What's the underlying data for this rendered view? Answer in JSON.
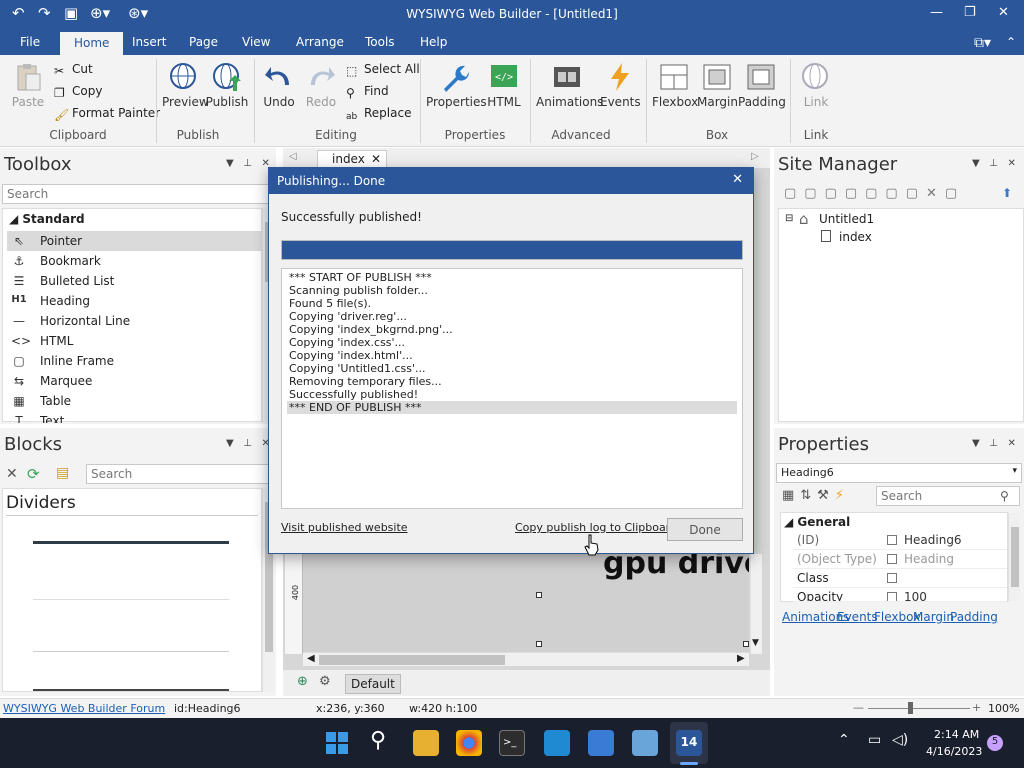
{
  "window": {
    "title": "WYSIWYG Web Builder - [Untitled1]"
  },
  "menu": [
    "File",
    "Home",
    "Insert",
    "Page",
    "View",
    "Arrange",
    "Tools",
    "Help"
  ],
  "menu_active": "Home",
  "ribbon": {
    "clipboard": {
      "paste": "Paste",
      "cut": "Cut",
      "copy": "Copy",
      "format_painter": "Format Painter",
      "label": "Clipboard"
    },
    "publish": {
      "preview": "Preview",
      "publish": "Publish",
      "label": "Publish"
    },
    "editing": {
      "undo": "Undo",
      "redo": "Redo",
      "select_all": "Select All",
      "find": "Find",
      "replace": "Replace",
      "label": "Editing"
    },
    "properties": {
      "properties": "Properties",
      "html": "HTML",
      "label": "Properties"
    },
    "advanced": {
      "animations": "Animations",
      "events": "Events",
      "label": "Advanced"
    },
    "box": {
      "flexbox": "Flexbox",
      "margin": "Margin",
      "padding": "Padding",
      "label": "Box"
    },
    "link": {
      "link": "Link",
      "label": "Link"
    }
  },
  "toolbox": {
    "title": "Toolbox",
    "search_placeholder": "Search",
    "category": "Standard",
    "items": [
      {
        "label": "Pointer",
        "icon": "pointer-icon"
      },
      {
        "label": "Bookmark",
        "icon": "anchor-icon"
      },
      {
        "label": "Bulleted List",
        "icon": "list-icon"
      },
      {
        "label": "Heading",
        "icon": "heading-icon"
      },
      {
        "label": "Horizontal Line",
        "icon": "line-icon"
      },
      {
        "label": "HTML",
        "icon": "code-icon"
      },
      {
        "label": "Inline Frame",
        "icon": "frame-icon"
      },
      {
        "label": "Marquee",
        "icon": "marquee-icon"
      },
      {
        "label": "Table",
        "icon": "table-icon"
      },
      {
        "label": "Text",
        "icon": "text-icon"
      }
    ]
  },
  "blocks": {
    "title": "Blocks",
    "search_placeholder": "Search",
    "section": "Dividers"
  },
  "editor": {
    "tab": "index",
    "canvas_text": "gpu driver",
    "ruler_mark": "400",
    "page_layer": "Default"
  },
  "site_manager": {
    "title": "Site Manager",
    "project": "Untitled1",
    "page": "index"
  },
  "properties": {
    "title": "Properties",
    "object": "Heading6",
    "search_placeholder": "Search",
    "section": "General",
    "rows": [
      {
        "name": "(ID)",
        "value": "Heading6"
      },
      {
        "name": "(Object Type)",
        "value": "Heading"
      },
      {
        "name": "Class",
        "value": ""
      },
      {
        "name": "Opacity",
        "value": "100"
      }
    ],
    "links": [
      "Animations",
      "Events",
      "Flexbox",
      "Margin",
      "Padding"
    ]
  },
  "dialog": {
    "title": "Publishing... Done",
    "message": "Successfully published!",
    "progress": 1.0,
    "log": [
      "*** START OF PUBLISH ***",
      "Scanning publish folder...",
      "Found 5 file(s).",
      "Copying 'driver.reg'...",
      "Copying 'index_bkgrnd.png'...",
      "Copying 'index.css'...",
      "Copying 'index.html'...",
      "Copying 'Untitled1.css'...",
      "Removing temporary files...",
      "Successfully published!",
      "*** END OF PUBLISH ***"
    ],
    "visit_link": "Visit published website",
    "copy_link": "Copy publish log to Clipboard",
    "done": "Done"
  },
  "status": {
    "forum": "WYSIWYG Web Builder Forum",
    "id": "id:Heading6",
    "coords": "x:236, y:360",
    "size": "w:420 h:100",
    "zoom": "100%"
  },
  "taskbar": {
    "time": "2:14 AM",
    "date": "4/16/2023",
    "notifications": "5"
  },
  "colors": {
    "accent": "#2b579a",
    "ribbon_bg": "#f3f3f3",
    "taskbar": "#1a1f2e"
  }
}
